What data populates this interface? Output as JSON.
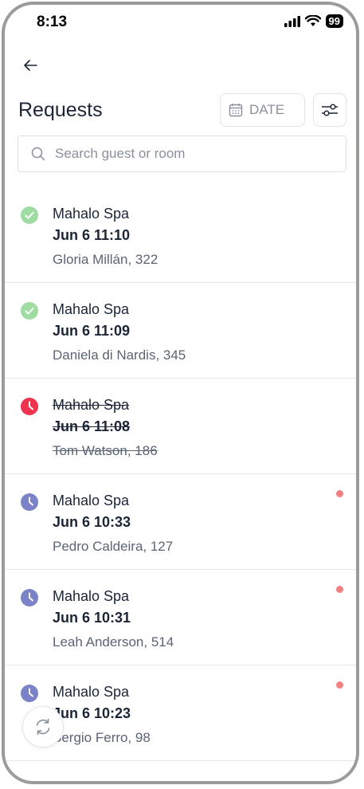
{
  "status_bar": {
    "time": "8:13",
    "battery": "99"
  },
  "header": {
    "title": "Requests",
    "date_label": "DATE"
  },
  "search": {
    "placeholder": "Search guest or room"
  },
  "requests": [
    {
      "service": "Mahalo Spa",
      "when": "Jun 6 11:10",
      "guest": "Gloria Millán, 322",
      "status": "completed",
      "unread": false
    },
    {
      "service": "Mahalo Spa",
      "when": "Jun 6 11:09",
      "guest": "Daniela di Nardis, 345",
      "status": "completed",
      "unread": false
    },
    {
      "service": "Mahalo Spa",
      "when": "Jun 6 11:08",
      "guest": "Tom Watson, 186",
      "status": "cancelled",
      "unread": false
    },
    {
      "service": "Mahalo Spa",
      "when": "Jun 6 10:33",
      "guest": "Pedro Caldeira, 127",
      "status": "pending",
      "unread": true
    },
    {
      "service": "Mahalo Spa",
      "when": "Jun 6 10:31",
      "guest": "Leah Anderson, 514",
      "status": "pending",
      "unread": true
    },
    {
      "service": "Mahalo Spa",
      "when": "Jun 6 10:23",
      "guest": "Sergio Ferro, 98",
      "status": "pending",
      "unread": true
    }
  ],
  "colors": {
    "completed": "#9fdca2",
    "cancelled": "#f0344f",
    "pending": "#7a83c7",
    "unread_dot": "#f28080",
    "text": "#1b2536"
  },
  "icons": {
    "back": "arrow-left-icon",
    "date": "calendar-icon",
    "filter": "sliders-icon",
    "search": "search-icon",
    "refresh": "refresh-icon"
  }
}
